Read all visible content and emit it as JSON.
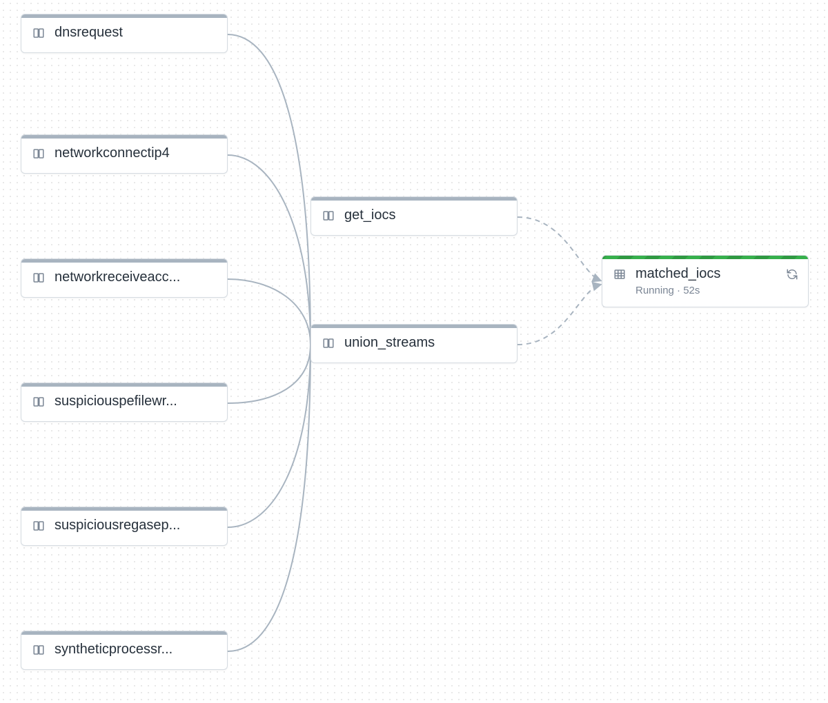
{
  "nodes": {
    "dnsrequest": {
      "label": "dnsrequest",
      "icon": "column"
    },
    "networkconnectip4": {
      "label": "networkconnectip4",
      "icon": "column"
    },
    "networkreceiveacc": {
      "label": "networkreceiveacc...",
      "icon": "column"
    },
    "suspiciouspefilewr": {
      "label": "suspiciouspefilewr...",
      "icon": "column"
    },
    "suspiciousregasep": {
      "label": "suspiciousregasep...",
      "icon": "column"
    },
    "syntheticprocessr": {
      "label": "syntheticprocessr...",
      "icon": "column"
    },
    "get_iocs": {
      "label": "get_iocs",
      "icon": "column"
    },
    "union_streams": {
      "label": "union_streams",
      "icon": "column"
    },
    "matched_iocs": {
      "label": "matched_iocs",
      "icon": "table",
      "status": "Running · 52s",
      "running": true
    }
  },
  "colors": {
    "node_border": "#d5dbe1",
    "node_topbar": "#a8b4c0",
    "running_green_a": "#36b04c",
    "running_green_b": "#2e9941",
    "connector": "#a8b4c0",
    "text": "#26303b",
    "muted": "#7a8594"
  }
}
